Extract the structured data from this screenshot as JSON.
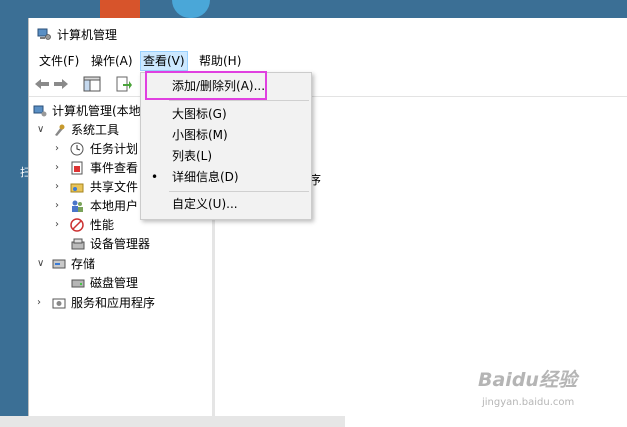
{
  "window": {
    "title": "计算机管理"
  },
  "menubar": [
    {
      "label": "文件(F)"
    },
    {
      "label": "操作(A)"
    },
    {
      "label": "查看(V)"
    },
    {
      "label": "帮助(H)"
    }
  ],
  "tree": {
    "root": "计算机管理(本地",
    "system_tools": "系统工具",
    "task_scheduler": "任务计划",
    "event_viewer": "事件查看",
    "shared_folders": "共享文件",
    "local_users": "本地用户",
    "performance": "性能",
    "device_manager": "设备管理器",
    "storage": "存储",
    "disk_management": "磁盘管理",
    "services_apps": "服务和应用程序"
  },
  "view_menu": {
    "add_remove_columns": "添加/删除列(A)...",
    "large_icons": "大图标(G)",
    "small_icons": "小图标(M)",
    "list": "列表(L)",
    "details": "详细信息(D)",
    "details_selected_mark": "•",
    "customize": "自定义(U)..."
  },
  "right_pane": {
    "fragment": "序"
  },
  "desktop": {
    "shortcut_fragment": "扫"
  },
  "watermark": {
    "brand": "Baidu经验",
    "url": "jingyan.baidu.com"
  },
  "colors": {
    "menu_active": "#cce8ff",
    "highlight_box": "#e040e0",
    "desktop": "#3b6f95"
  },
  "icons": {
    "app": "computer-management-icon",
    "back": "back-arrow-icon",
    "forward": "forward-arrow-icon"
  }
}
